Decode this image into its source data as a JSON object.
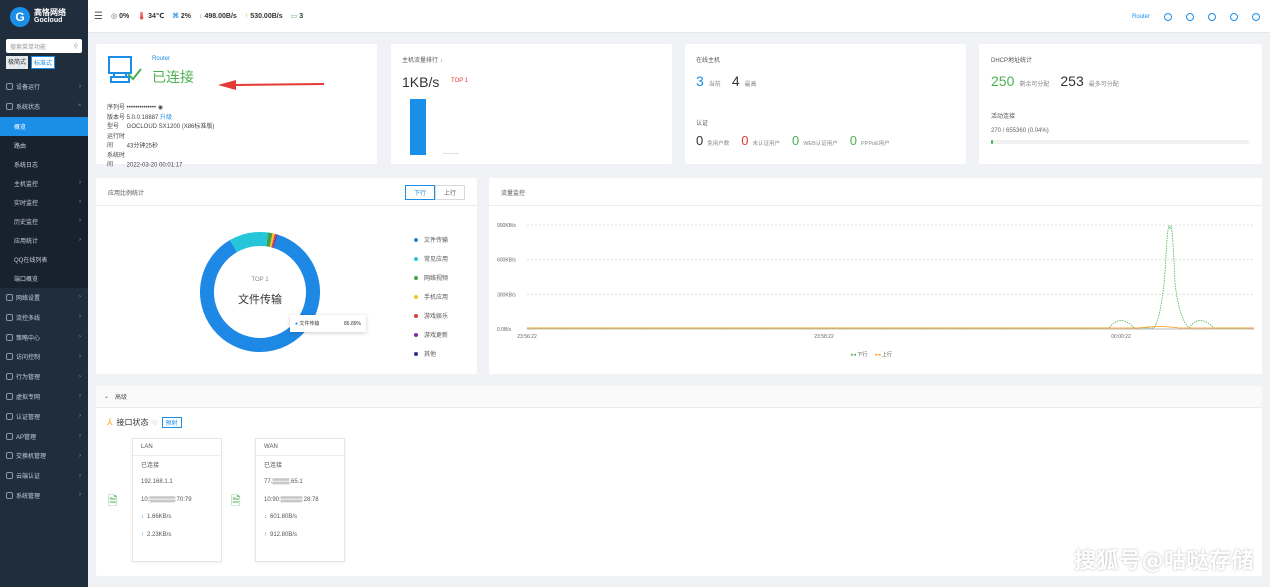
{
  "brand": {
    "name_cn": "高恪网络",
    "name_en": "Gocloud",
    "logo_letter": "G"
  },
  "sidebar": {
    "search_placeholder": "搜索菜单功能",
    "modes": [
      "极简式",
      "标准式"
    ],
    "items": [
      {
        "label": "设备运行",
        "chev": "›"
      },
      {
        "label": "系统状态",
        "chev": "^",
        "expanded": true
      }
    ],
    "subitems": [
      {
        "label": "概览",
        "active": true
      },
      {
        "label": "路由"
      },
      {
        "label": "系统日志"
      },
      {
        "label": "主机监控",
        "chev": "›"
      },
      {
        "label": "实时监控",
        "chev": "›"
      },
      {
        "label": "历史监控",
        "chev": "›"
      },
      {
        "label": "应用统计",
        "chev": "›"
      },
      {
        "label": "QQ在线列表"
      },
      {
        "label": "端口概览"
      }
    ],
    "groups": [
      {
        "label": "网络设置",
        "chev": "›"
      },
      {
        "label": "流控多线",
        "chev": "›"
      },
      {
        "label": "策略中心",
        "chev": "›"
      },
      {
        "label": "访问控制",
        "chev": "›"
      },
      {
        "label": "行为管理",
        "chev": "›"
      },
      {
        "label": "虚拟专网",
        "chev": "›"
      },
      {
        "label": "认证管理",
        "chev": "›"
      },
      {
        "label": "AP管理",
        "chev": "›"
      },
      {
        "label": "交换机管理",
        "chev": "›"
      },
      {
        "label": "云端认证",
        "chev": "›"
      },
      {
        "label": "系统管理",
        "chev": "›"
      }
    ]
  },
  "topbar": {
    "menu_icon": "☰",
    "cpu": "0%",
    "temp": "34℃",
    "mem": "2%",
    "down": "498.00B/s",
    "up": "530.00B/s",
    "devices": "3",
    "right": [
      "Router"
    ]
  },
  "router_card": {
    "label": "Router",
    "status": "已连接",
    "serial_label": "序列号",
    "serial_value": "••••••••••••••",
    "version_label": "版本号",
    "version_value": "5.0.0.18887",
    "upgrade": "升级",
    "model_label": "型号",
    "model_value": "GOCLOUD SX1200 (X86标准版)",
    "uptime_label": "运行时间",
    "uptime_value": "43分钟25秒",
    "start_label": "系统时间",
    "start_value": "2022-03-20 00:01:17"
  },
  "traffic_rank": {
    "title": "主机流量排行",
    "value": "1KB/s",
    "tag": "TOP 1"
  },
  "online_card": {
    "title": "在线主机",
    "current_value": "3",
    "current_label": "当前",
    "max_value": "4",
    "max_label": "最高",
    "auth_title": "认证",
    "auth_items": [
      {
        "value": "0",
        "label": "免用户数"
      },
      {
        "value": "0",
        "label": "未认证用户"
      },
      {
        "value": "0",
        "label": "WEB认证用户"
      },
      {
        "value": "0",
        "label": "PPPoE用户"
      }
    ]
  },
  "dhcp_card": {
    "title": "DHCP地址统计",
    "allocated_value": "250",
    "allocated_label": "剩余可分配",
    "total_value": "253",
    "total_label": "最多可分配",
    "conn_title": "活动连接",
    "conn_value": "270 / 655360 (0.04%)",
    "conn_fraction": 0.0004
  },
  "app_card": {
    "title": "应用比例统计",
    "tabs": [
      "下行",
      "上行"
    ],
    "center_top": "TOP 1",
    "center_label": "文件传输",
    "tooltip_label": "文件传输",
    "tooltip_value": "86.89%",
    "legend": [
      {
        "label": "文件传输",
        "color": "#1e88e5"
      },
      {
        "label": "常见应用",
        "color": "#26c6da"
      },
      {
        "label": "网络视频",
        "color": "#43a047"
      },
      {
        "label": "手机应用",
        "color": "#fbc02d"
      },
      {
        "label": "游戏娱乐",
        "color": "#e53935"
      },
      {
        "label": "游戏更新",
        "color": "#8e24aa"
      },
      {
        "label": "其他",
        "color": "#283593"
      }
    ],
    "slices": [
      86.89,
      10.5,
      1.2,
      0.6,
      0.41,
      0.2,
      0.2
    ]
  },
  "flow_card": {
    "title": "流量监控",
    "legend_down": "下行",
    "legend_up": "上行"
  },
  "chart_data": {
    "type": "line",
    "y_ticks": [
      "900KB/s",
      "600KB/s",
      "300KB/s",
      "0.0B/s"
    ],
    "x_ticks": [
      "23:56:22",
      "23:58:22",
      "00:00:22"
    ],
    "ylim": [
      0,
      900
    ],
    "series": [
      {
        "name": "下行",
        "color": "#4caf50"
      },
      {
        "name": "上行",
        "color": "#ff9800"
      }
    ]
  },
  "interfaces": {
    "section_label": "高级",
    "title": "接口状态",
    "tag": "预射",
    "cards": [
      {
        "name": "LAN",
        "status": "已连接",
        "ip": "192.168.1.1",
        "mac": "10:▒▒▒▒▒▒:70:79",
        "down": "1.66KB/s",
        "up": "2.23KB/s"
      },
      {
        "name": "WAN",
        "status": "已连接",
        "ip": "77.▒▒▒▒.65.1",
        "mac": "10:90:▒▒▒▒▒:28:78",
        "down": "601.80B/s",
        "up": "912.80B/s"
      }
    ]
  },
  "watermark": "搜狐号@咕哒存储"
}
